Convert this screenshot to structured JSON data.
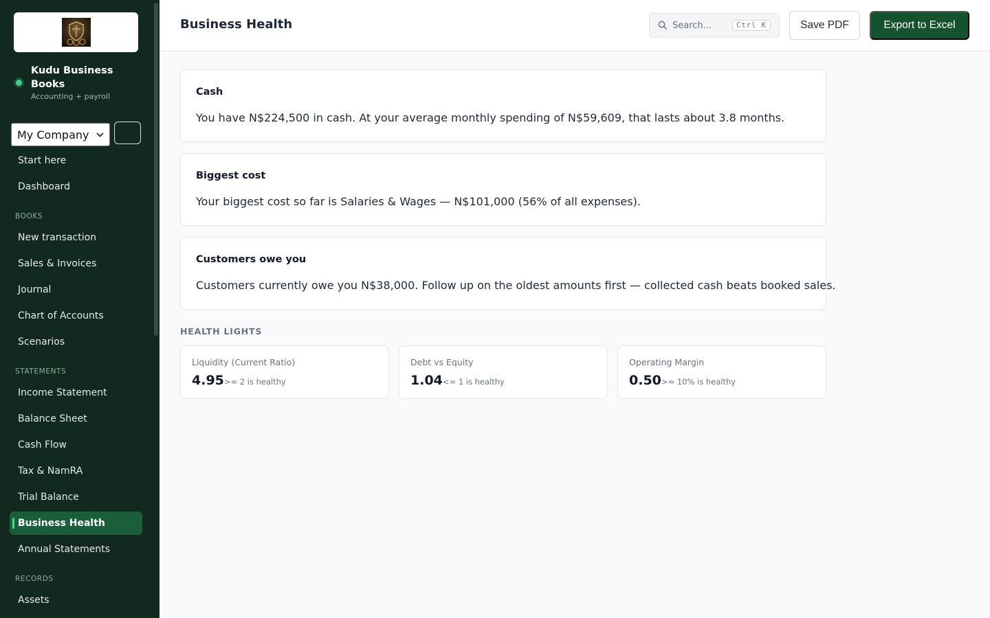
{
  "app": {
    "name": "Kudu Business Books",
    "subtitle": "Accounting + payroll"
  },
  "company_select": {
    "value": "My Company"
  },
  "nav": {
    "top": [
      {
        "label": "Start here"
      },
      {
        "label": "Dashboard"
      }
    ],
    "sections": [
      {
        "title": "BOOKS",
        "items": [
          {
            "label": "New transaction"
          },
          {
            "label": "Sales & Invoices"
          },
          {
            "label": "Journal"
          },
          {
            "label": "Chart of Accounts"
          },
          {
            "label": "Scenarios"
          }
        ]
      },
      {
        "title": "STATEMENTS",
        "items": [
          {
            "label": "Income Statement"
          },
          {
            "label": "Balance Sheet"
          },
          {
            "label": "Cash Flow"
          },
          {
            "label": "Tax & NamRA"
          },
          {
            "label": "Trial Balance"
          },
          {
            "label": "Business Health",
            "active": true
          },
          {
            "label": "Annual Statements"
          }
        ]
      },
      {
        "title": "RECORDS",
        "items": [
          {
            "label": "Assets"
          }
        ]
      }
    ]
  },
  "header": {
    "title": "Business Health",
    "search_placeholder": "Search...",
    "search_shortcut": "Ctrl K",
    "save_pdf_label": "Save PDF",
    "export_label": "Export to Excel"
  },
  "cards": [
    {
      "title": "Cash",
      "text": "You have N$224,500 in cash. At your average monthly spending of N$59,609, that lasts about 3.8 months."
    },
    {
      "title": "Biggest cost",
      "text": "Your biggest cost so far is Salaries & Wages — N$101,000 (56% of all expenses)."
    },
    {
      "title": "Customers owe you",
      "text": "Customers currently owe you N$38,000. Follow up on the oldest amounts first — collected cash beats booked sales."
    }
  ],
  "health_lights": {
    "title": "HEALTH LIGHTS",
    "items": [
      {
        "label": "Liquidity (Current Ratio)",
        "value": "4.95",
        "hint": ">= 2 is healthy"
      },
      {
        "label": "Debt vs Equity",
        "value": "1.04",
        "hint": "<= 1 is healthy"
      },
      {
        "label": "Operating Margin",
        "value": "0.50",
        "hint": ">= 10% is healthy"
      }
    ]
  },
  "colors": {
    "sidebar_bg": "#12291f",
    "active_nav_bg": "#1b5e3a",
    "primary_button": "#14532d",
    "status_dot": "#3ecf8e"
  }
}
